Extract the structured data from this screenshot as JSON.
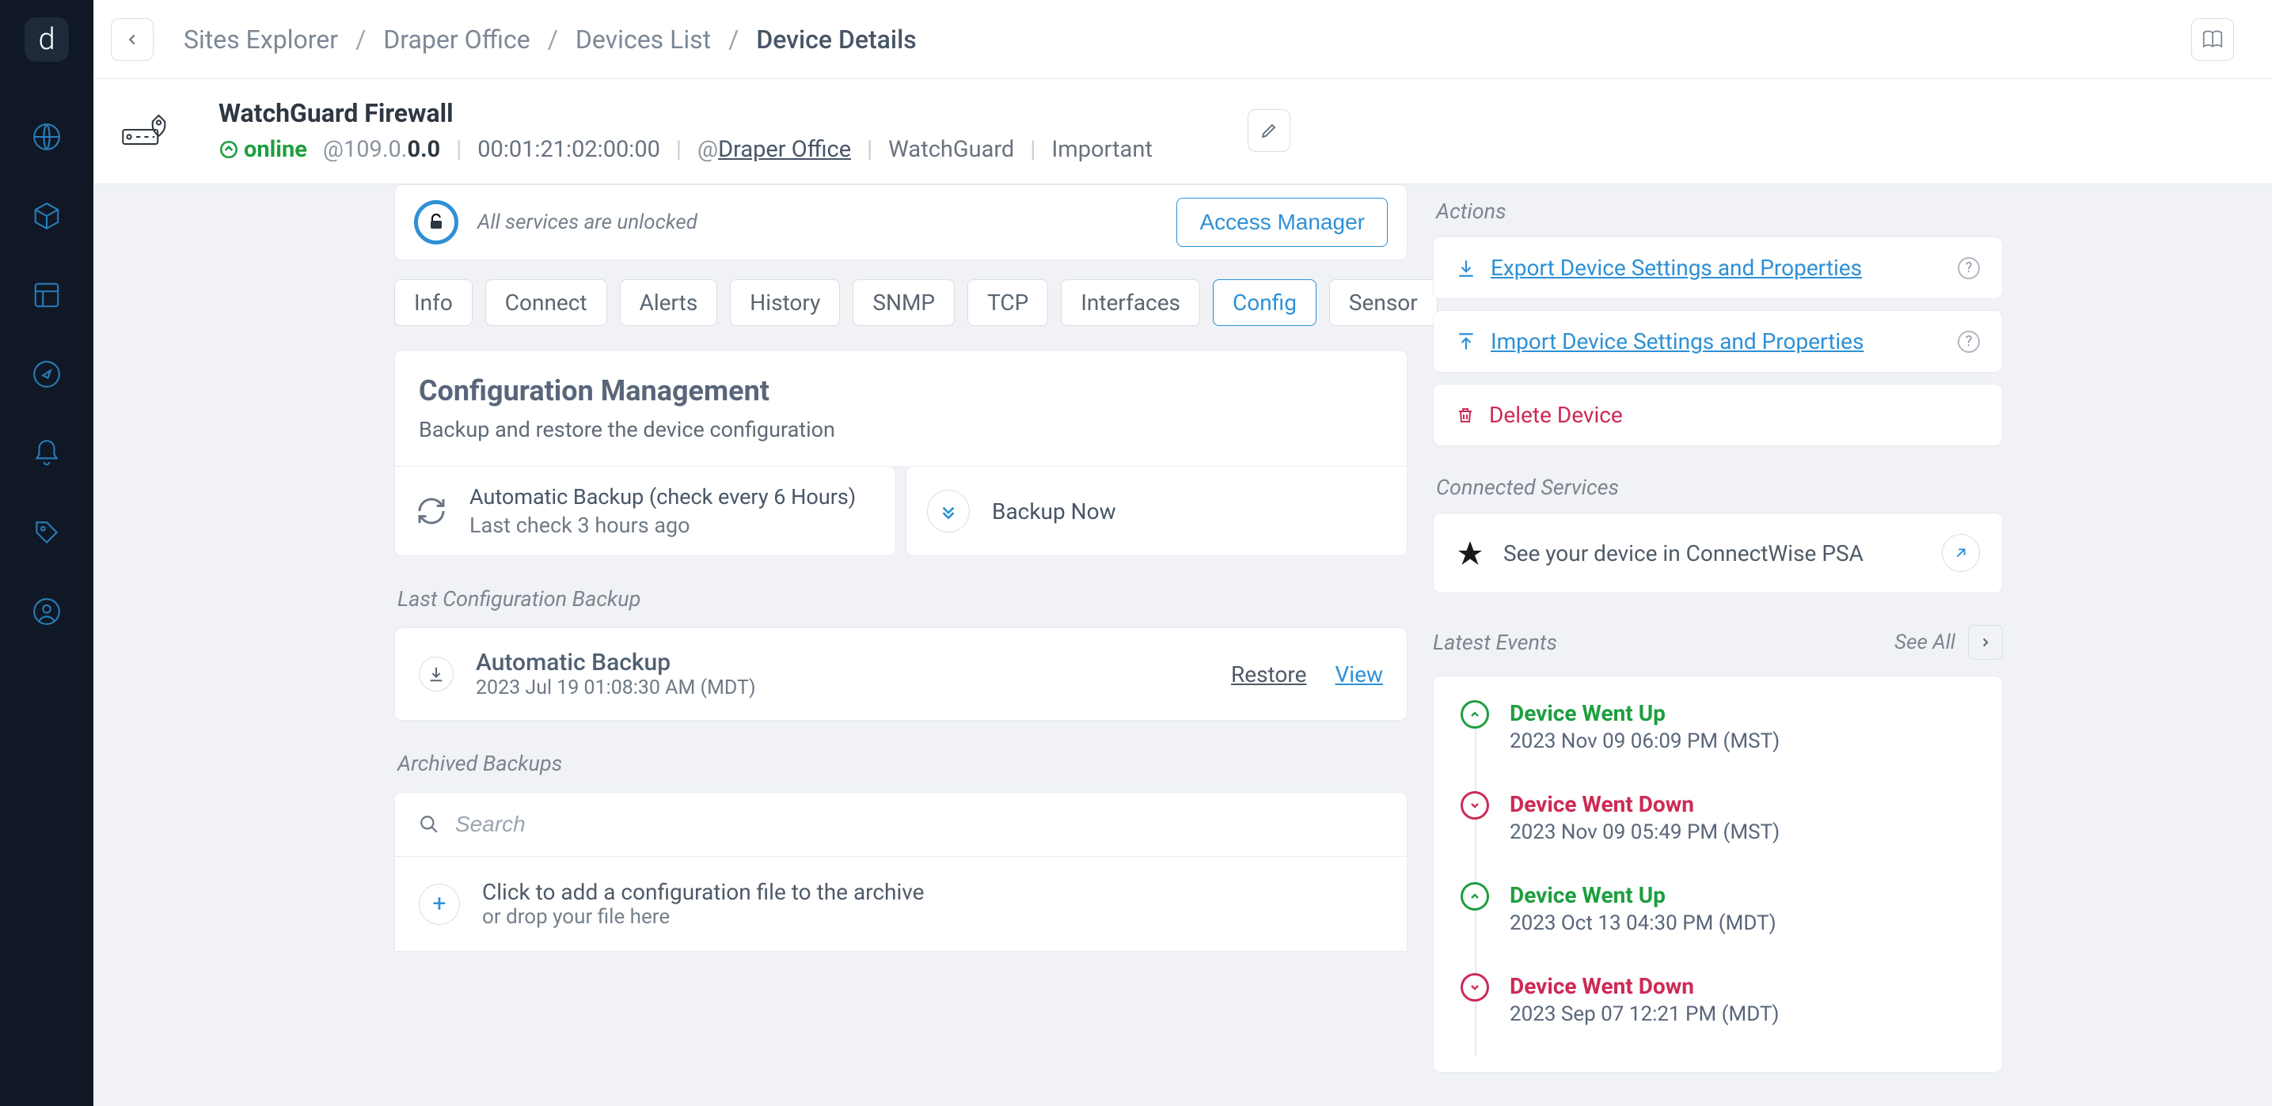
{
  "breadcrumb": {
    "items": [
      "Sites Explorer",
      "Draper Office",
      "Devices List"
    ],
    "current": "Device Details"
  },
  "device": {
    "title": "WatchGuard Firewall",
    "status": "online",
    "ip_prefix": "@109.0.",
    "ip_bold": "0.0",
    "mac": "00:01:21:02:00:00",
    "site_at": "@",
    "site": "Draper Office",
    "vendor": "WatchGuard",
    "importance": "Important"
  },
  "unlock": {
    "text": "All services are unlocked",
    "button": "Access Manager"
  },
  "tabs": [
    "Info",
    "Connect",
    "Alerts",
    "History",
    "SNMP",
    "TCP",
    "Interfaces",
    "Config",
    "Sensor"
  ],
  "active_tab": "Config",
  "config": {
    "title": "Configuration Management",
    "subtitle": "Backup and restore the device configuration",
    "auto_line1": "Automatic Backup (check every 6 Hours)",
    "auto_line2": "Last check 3 hours ago",
    "backup_now": "Backup Now"
  },
  "last_backup_label": "Last Configuration Backup",
  "last_backup": {
    "title": "Automatic Backup",
    "time": "2023 Jul 19 01:08:30 AM (MDT)",
    "restore": "Restore",
    "view": "View"
  },
  "archived_label": "Archived Backups",
  "search_placeholder": "Search",
  "add_config": {
    "line1": "Click to add a configuration file to the archive",
    "line2": "or drop your file here"
  },
  "actions_label": "Actions",
  "actions": {
    "export": "Export Device Settings and Properties",
    "import": "Import Device Settings and Properties",
    "delete": "Delete Device"
  },
  "connected_label": "Connected Services",
  "connectwise": "See your device in ConnectWise PSA",
  "events_label": "Latest Events",
  "see_all": "See All",
  "events": [
    {
      "type": "up",
      "title": "Device Went Up",
      "time": "2023 Nov 09 06:09 PM (MST)"
    },
    {
      "type": "down",
      "title": "Device Went Down",
      "time": "2023 Nov 09 05:49 PM (MST)"
    },
    {
      "type": "up",
      "title": "Device Went Up",
      "time": "2023 Oct 13 04:30 PM (MDT)"
    },
    {
      "type": "down",
      "title": "Device Went Down",
      "time": "2023 Sep 07 12:21 PM (MDT)"
    }
  ]
}
